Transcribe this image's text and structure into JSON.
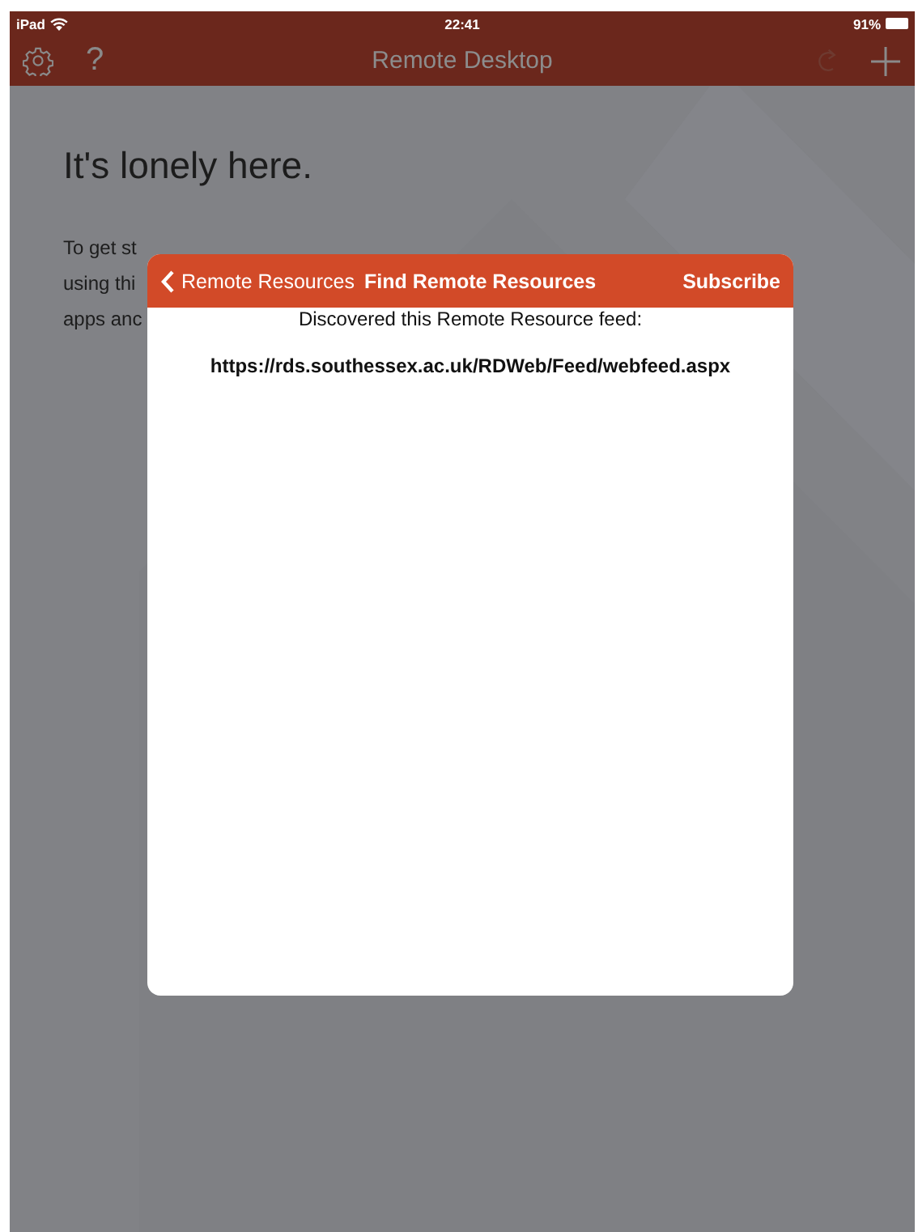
{
  "status_bar": {
    "device": "iPad",
    "time": "22:41",
    "battery": "91%"
  },
  "nav_bar": {
    "title": "Remote Desktop",
    "help_glyph": "?"
  },
  "empty_state": {
    "heading": "It's lonely here.",
    "lines": [
      "To get st",
      "using thi",
      "apps anc"
    ]
  },
  "dialog": {
    "back": "Remote Resources",
    "title": "Find Remote Resources",
    "action": "Subscribe",
    "message": "Discovered this Remote Resource feed:",
    "url": "https://rds.southessex.ac.uk/RDWeb/Feed/webfeed.aspx"
  }
}
